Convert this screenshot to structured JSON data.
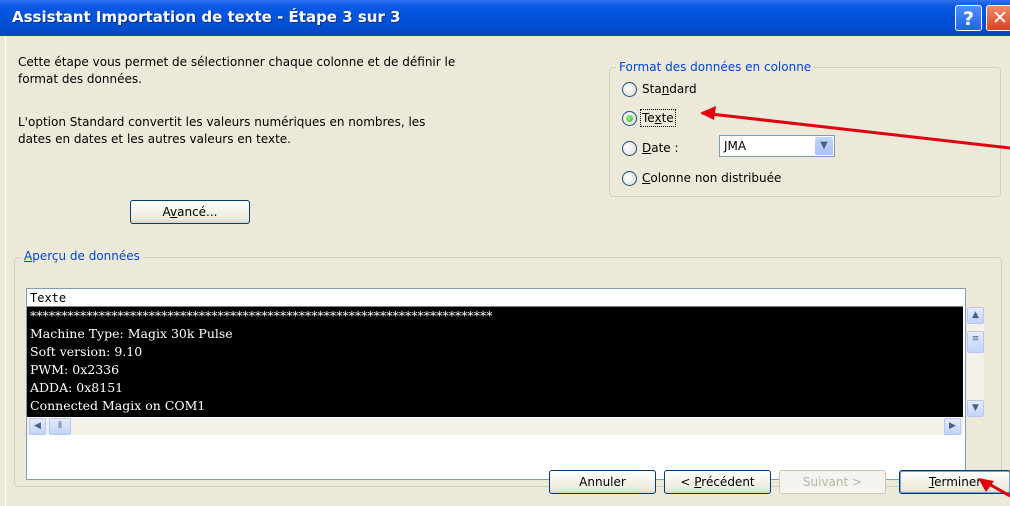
{
  "window": {
    "title": "Assistant Importation de texte - Étape 3 sur 3",
    "help_glyph": "?",
    "close_glyph": "✕"
  },
  "description": {
    "line1": "Cette étape vous permet de sélectionner chaque colonne et de définir le",
    "line2": "format des données.",
    "line3": "L'option Standard convertit les valeurs numériques en nombres, les",
    "line4": "dates en dates et les autres valeurs en texte."
  },
  "advanced_button": {
    "before": "A",
    "accel": "v",
    "after": "ancé..."
  },
  "format_group": {
    "label": "Format des données en colonne",
    "options": [
      {
        "before": "Sta",
        "accel": "n",
        "after": "dard",
        "selected": false
      },
      {
        "before": "Te",
        "accel": "x",
        "after": "te",
        "selected": true
      },
      {
        "before": "",
        "accel": "D",
        "after": "ate :",
        "selected": false
      },
      {
        "before": "",
        "accel": "C",
        "after": "olonne non distribuée",
        "selected": false
      }
    ],
    "date_format": "JMA"
  },
  "preview": {
    "label_accel": "A",
    "label_rest": "perçu de données",
    "column_header": "Texte",
    "lines": [
      "**************************************************************************",
      "Machine Type: Magix 30k Pulse",
      "Soft version: 9.10",
      "PWM: 0x2336",
      "ADDA: 0x8151",
      "Connected Magix on COM1"
    ]
  },
  "footer": {
    "cancel": "Annuler",
    "previous_before": "< ",
    "previous_accel": "P",
    "previous_after": "récédent",
    "next": "Suivant >",
    "finish_accel": "T",
    "finish_after": "erminer"
  },
  "colors": {
    "title_bar": "#0051d8",
    "group_label": "#0046d5",
    "annotation_arrow": "#e0000f"
  }
}
